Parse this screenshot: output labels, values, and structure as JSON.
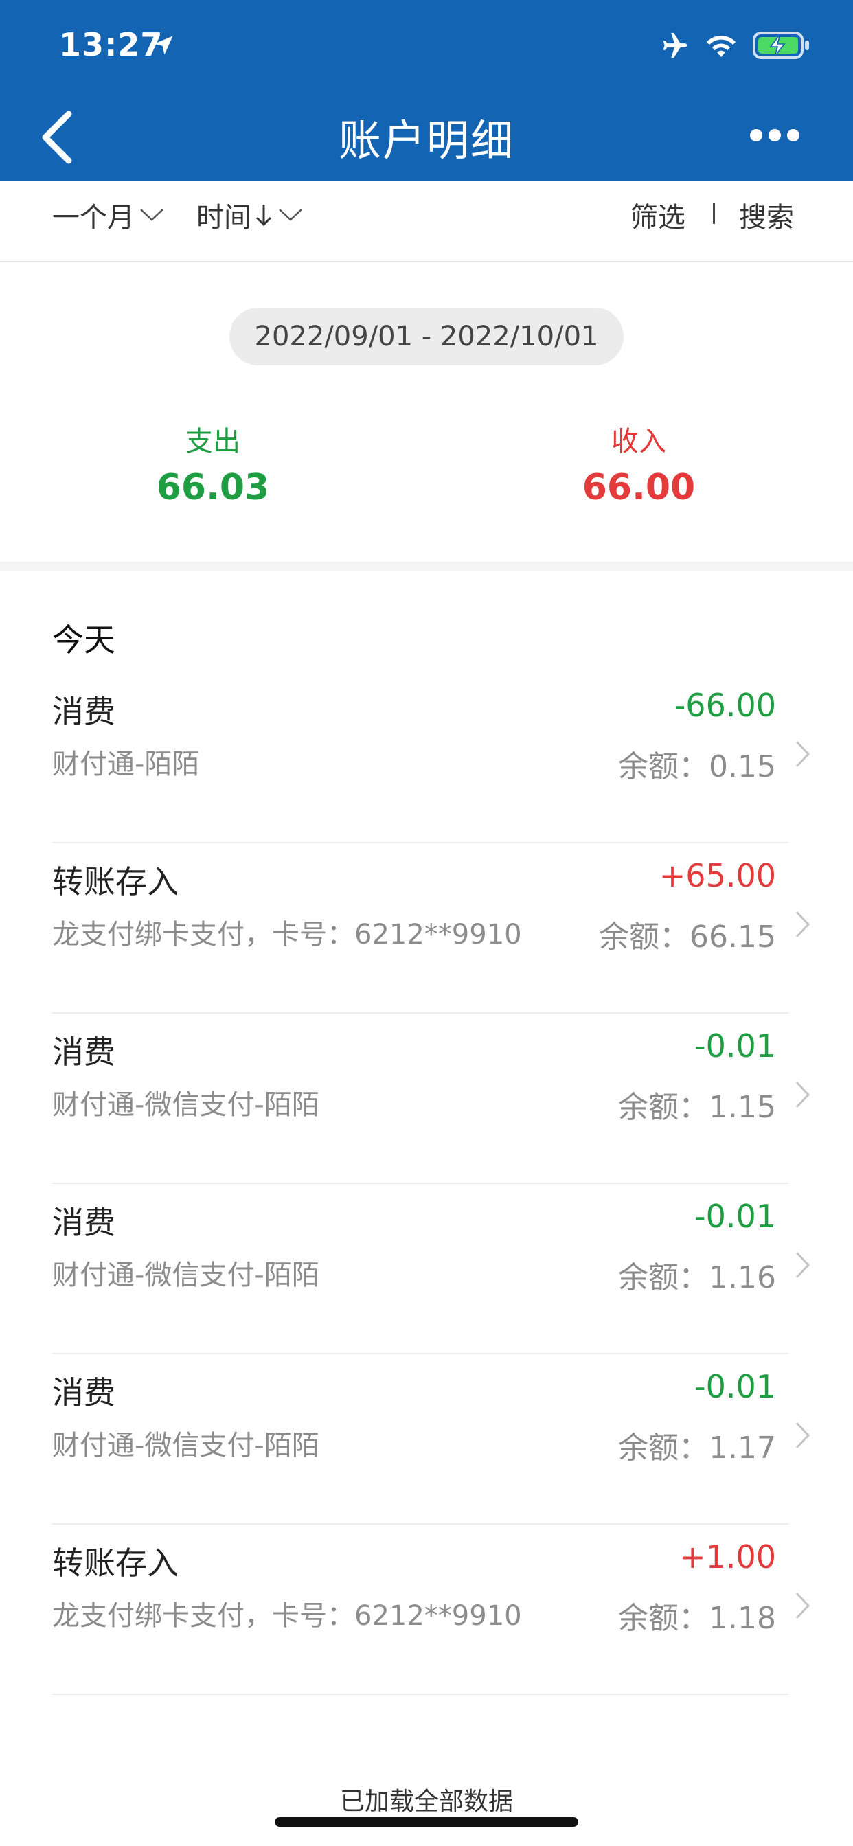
{
  "status": {
    "time": "13:27"
  },
  "nav": {
    "title": "账户明细"
  },
  "toolbar": {
    "period": "一个月",
    "sort": "时间",
    "filter": "筛选",
    "search": "搜索"
  },
  "summary": {
    "date_range": "2022/09/01 - 2022/10/01",
    "expense_label": "支出",
    "expense_value": "66.03",
    "income_label": "收入",
    "income_value": "66.00"
  },
  "section": {
    "title": "今天"
  },
  "transactions": [
    {
      "title": "消费",
      "subtitle": "财付通-陌陌",
      "amount": "-66.00",
      "balance": "余额：0.15",
      "type": "out"
    },
    {
      "title": "转账存入",
      "subtitle": "龙支付绑卡支付，卡号：6212**9910",
      "amount": "+65.00",
      "balance": "余额：66.15",
      "type": "in"
    },
    {
      "title": "消费",
      "subtitle": "财付通-微信支付-陌陌",
      "amount": "-0.01",
      "balance": "余额：1.15",
      "type": "out"
    },
    {
      "title": "消费",
      "subtitle": "财付通-微信支付-陌陌",
      "amount": "-0.01",
      "balance": "余额：1.16",
      "type": "out"
    },
    {
      "title": "消费",
      "subtitle": "财付通-微信支付-陌陌",
      "amount": "-0.01",
      "balance": "余额：1.17",
      "type": "out"
    },
    {
      "title": "转账存入",
      "subtitle": "龙支付绑卡支付，卡号：6212**9910",
      "amount": "+1.00",
      "balance": "余额：1.18",
      "type": "in"
    }
  ],
  "footer": {
    "text": "已加载全部数据"
  },
  "colors": {
    "header": "#1464b4",
    "expense": "#1f9d42",
    "income": "#e33b3b"
  }
}
